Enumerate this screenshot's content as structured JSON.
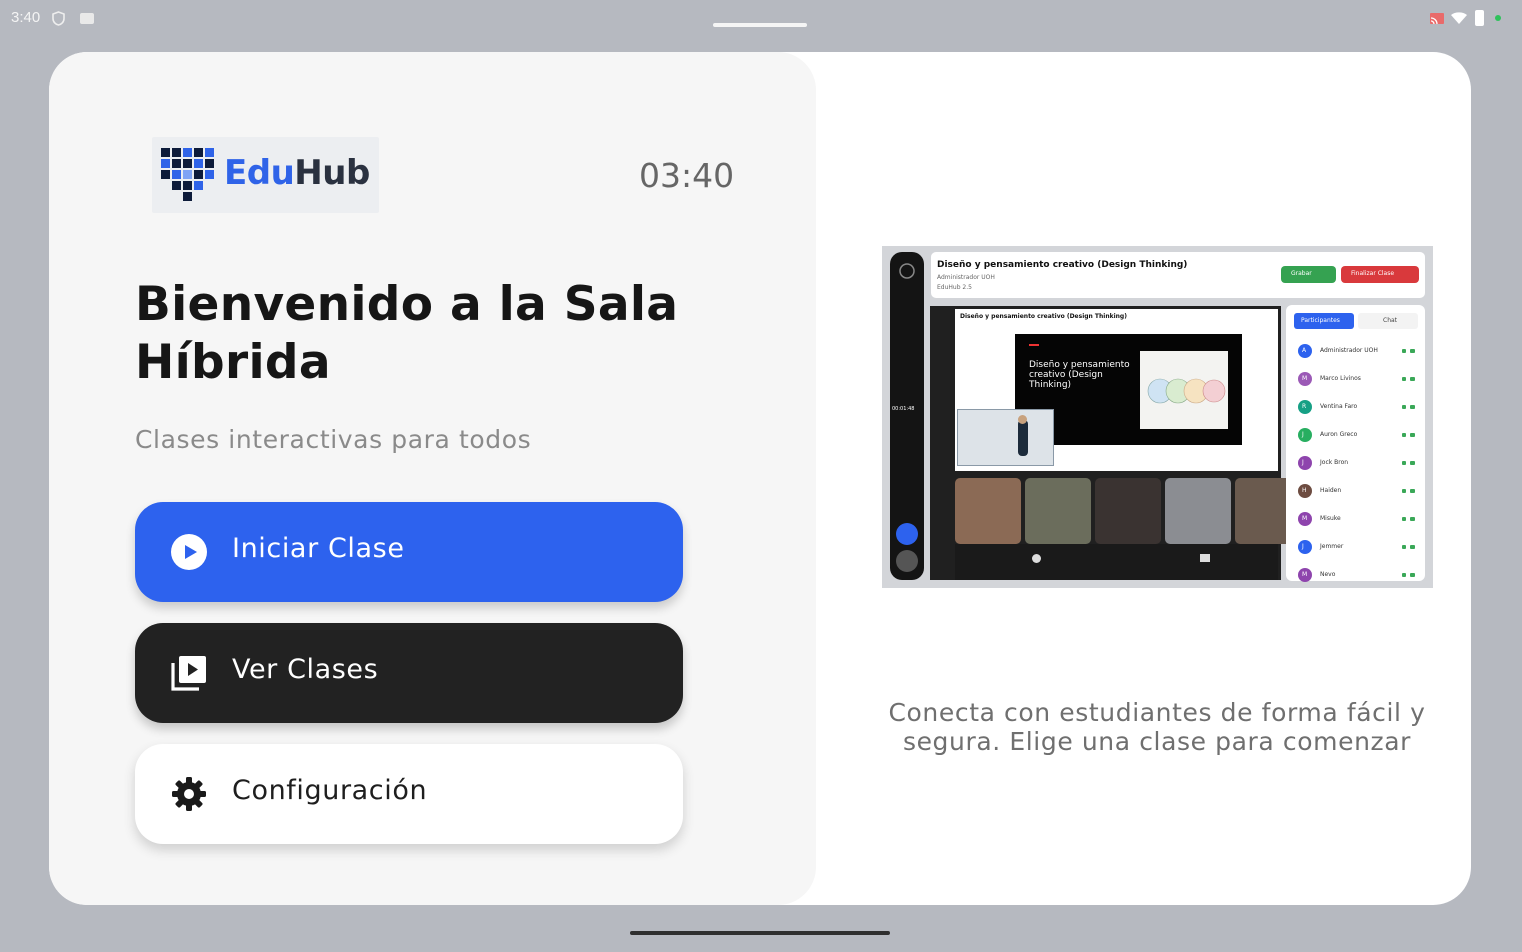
{
  "status_bar": {
    "time": "3:40",
    "icons": [
      "shield-icon",
      "sim-card-icon",
      "cast-icon",
      "wifi-icon",
      "battery-icon"
    ],
    "dot_color": "#2ec25b"
  },
  "header": {
    "logo_edu": "Edu",
    "logo_hub": "Hub",
    "clock": "03:40"
  },
  "welcome": {
    "title": "Bienvenido a la Sala Híbrida",
    "subtitle": "Clases interactivas para todos"
  },
  "actions": {
    "start_label": "Iniciar Clase",
    "view_label": "Ver Clases",
    "config_label": "Configuración"
  },
  "preview": {
    "class_title": "Diseño y pensamiento creativo (Design Thinking)",
    "class_admin": "Administrador UOH",
    "class_org": "EduHub 2.5",
    "record_label": "Grabar",
    "end_label": "Finalizar Clase",
    "slide_title": "Diseño y pensamiento creativo (Design Thinking)",
    "timer": "00:01:48",
    "tab_participants": "Participantes",
    "tab_chat": "Chat",
    "participants": [
      {
        "initial": "A",
        "name": "Administrador UOH",
        "color": "#2d62ee"
      },
      {
        "initial": "M",
        "name": "Marco Livinos",
        "color": "#9b59b6"
      },
      {
        "initial": "R",
        "name": "Ventina Faro",
        "color": "#16a085"
      },
      {
        "initial": "J",
        "name": "Auron Greco",
        "color": "#27ae60"
      },
      {
        "initial": "J",
        "name": "Jock Bron",
        "color": "#8e44ad"
      },
      {
        "initial": "H",
        "name": "Haiden",
        "color": "#6d4c41"
      },
      {
        "initial": "M",
        "name": "Misuke",
        "color": "#8e44ad"
      },
      {
        "initial": "J",
        "name": "Jemmer",
        "color": "#2d62ee"
      },
      {
        "initial": "M",
        "name": "Nevo",
        "color": "#8e44ad"
      }
    ]
  },
  "tagline": "Conecta con estudiantes de forma fácil y segura. Elige una clase para comenzar",
  "colors": {
    "primary": "#2d62ee",
    "dark": "#222222",
    "accent_green": "#35a251",
    "accent_red": "#d9393c"
  }
}
